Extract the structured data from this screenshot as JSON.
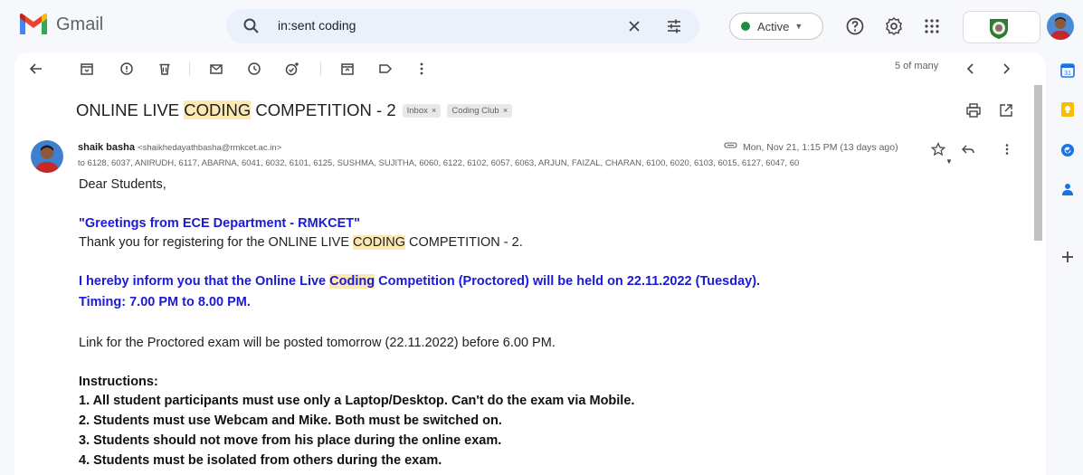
{
  "app": {
    "name": "Gmail"
  },
  "search": {
    "query": "in:sent coding"
  },
  "status": {
    "label": "Active",
    "color": "#1e8e3e"
  },
  "toolbar": {
    "pager": "5 of many"
  },
  "email": {
    "subject_pre": "ONLINE LIVE ",
    "subject_hl": "CODING",
    "subject_post": " COMPETITION - 2",
    "labels": [
      {
        "text": "Inbox",
        "close": "×"
      },
      {
        "text": "Coding Club",
        "close": "×"
      }
    ],
    "sender_name": "shaik basha",
    "sender_email": "<shaikhedayathbasha@rmkcet.ac.in>",
    "date": "Mon, Nov 21, 1:15 PM (13 days ago)",
    "to": "to 6128, 6037, ANIRUDH, 6117, ABARNA, 6041, 6032, 6101, 6125, SUSHMA, SUJITHA, 6060, 6122, 6102, 6057, 6063, ARJUN, FAIZAL, CHARAN, 6100, 6020, 6103, 6015, 6127, 6047, 60",
    "body": {
      "greeting": "Dear Students,",
      "greetings_line": "\"Greetings from ECE Department - RMKCET\"",
      "thanks_pre": "Thank you for registering for the ONLINE LIVE ",
      "thanks_hl": "CODING",
      "thanks_post": " COMPETITION - 2.",
      "inform_pre": "I hereby inform you that the Online Live ",
      "inform_hl": "Coding",
      "inform_post": " Competition (Proctored) will be held on 22.11.2022 (Tuesday).",
      "timing": "Timing: 7.00 PM to 8.00 PM.",
      "link_line": "Link for the Proctored exam will be posted tomorrow (22.11.2022) before 6.00 PM.",
      "instructions_title": "Instructions:",
      "instructions": [
        "1. All student participants must use only a Laptop/Desktop. Can't do the exam via Mobile.",
        "2. Students must use Webcam and Mike. Both must be switched on.",
        "3. Students should not move from his place during the online exam.",
        "4. Students must be isolated from others during the exam."
      ]
    }
  },
  "colors": {
    "highlight": "#fce8b2",
    "blue_text": "#1a1ad6",
    "gmail_red": "#ea4335"
  },
  "icons": [
    "search-icon",
    "clear-icon",
    "filter-icon",
    "help-icon",
    "settings-icon",
    "apps-icon",
    "back-icon",
    "archive-icon",
    "report-icon",
    "delete-icon",
    "mark-unread-icon",
    "snooze-icon",
    "add-task-icon",
    "move-icon",
    "label-icon",
    "more-icon",
    "prev-icon",
    "next-icon",
    "print-icon",
    "open-new-window-icon",
    "attachment-icon",
    "star-icon",
    "reply-icon",
    "calendar-icon",
    "keep-icon",
    "tasks-icon",
    "contacts-icon",
    "add-icon"
  ]
}
